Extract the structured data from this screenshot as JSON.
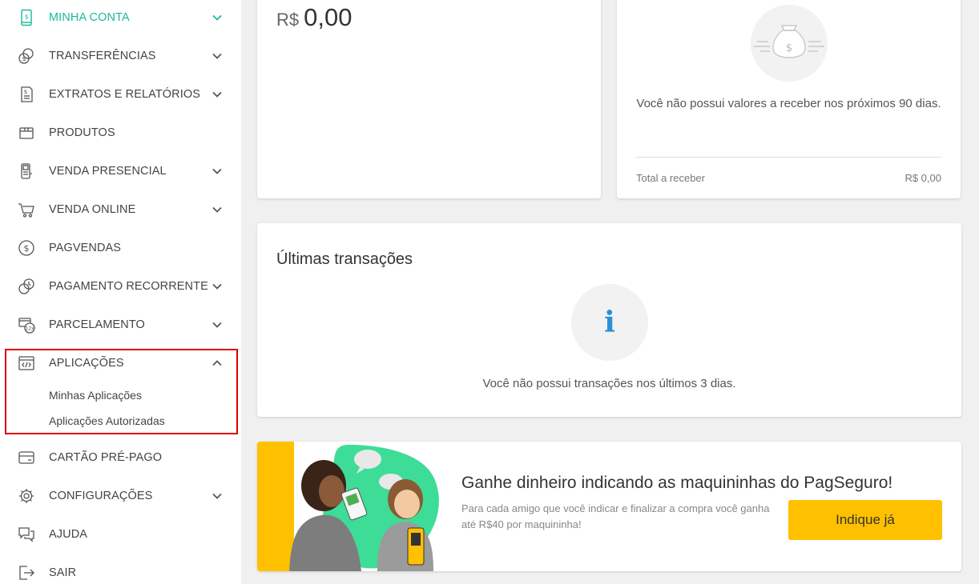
{
  "colors": {
    "accent": "#1bb99a",
    "brand_yellow": "#ffc000",
    "highlight": "#e00000",
    "info_blue": "#2c8fd6"
  },
  "sidebar": {
    "items": [
      {
        "label": "MINHA CONTA",
        "icon": "phone-dollar-icon"
      },
      {
        "label": "TRANSFERÊNCIAS",
        "icon": "coins-transfer-icon"
      },
      {
        "label": "EXTRATOS E RELATÓRIOS",
        "icon": "receipt-icon"
      },
      {
        "label": "PRODUTOS",
        "icon": "box-icon"
      },
      {
        "label": "VENDA PRESENCIAL",
        "icon": "card-machine-icon"
      },
      {
        "label": "VENDA ONLINE",
        "icon": "cart-icon"
      },
      {
        "label": "PAGVENDAS",
        "icon": "dollar-circle-icon"
      },
      {
        "label": "PAGAMENTO RECORRENTE",
        "icon": "recurring-coins-icon"
      },
      {
        "label": "PARCELAMENTO",
        "icon": "installments-icon"
      },
      {
        "label": "APLICAÇÕES",
        "icon": "code-window-icon"
      },
      {
        "label": "CARTÃO PRÉ-PAGO",
        "icon": "credit-card-icon"
      },
      {
        "label": "CONFIGURAÇÕES",
        "icon": "gear-icon"
      },
      {
        "label": "AJUDA",
        "icon": "chat-bubbles-icon"
      },
      {
        "label": "SAIR",
        "icon": "exit-icon"
      }
    ],
    "sub_items": [
      "Minhas Aplicações",
      "Aplicações Autorizadas"
    ]
  },
  "balance": {
    "currency": "R$",
    "value": "0,00"
  },
  "receivables": {
    "message": "Você não possui valores a receber nos próximos 90 dias.",
    "total_label": "Total a receber",
    "total_value": "R$ 0,00"
  },
  "transactions": {
    "title": "Últimas transações",
    "icon_glyph": "i",
    "message": "Você não possui transações nos últimos 3 dias."
  },
  "promo": {
    "title": "Ganhe dinheiro indicando as maquininhas do PagSeguro!",
    "description": "Para cada amigo que você indicar e finalizar a compra você ganha até R$40 por maquininha!",
    "button_label": "Indique já"
  }
}
